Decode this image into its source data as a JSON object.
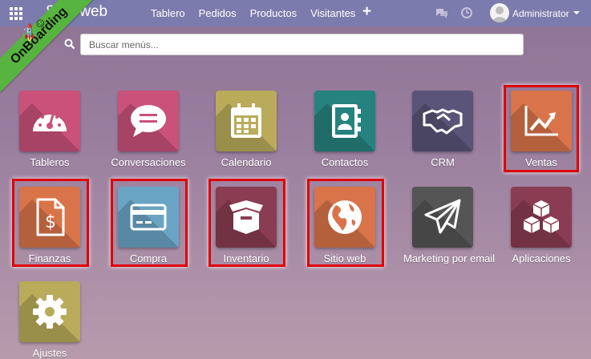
{
  "topbar": {
    "brand": "Sitio web",
    "nav": [
      "Tablero",
      "Pedidos",
      "Productos",
      "Visitantes"
    ],
    "plus": "+",
    "user": "Administrator",
    "icons": [
      "apps-grid-icon",
      "chat-icon",
      "clock-icon",
      "avatar"
    ],
    "color": "#7c7bad"
  },
  "ribbon": {
    "label": "OnBoarding",
    "icons": "🚀☺",
    "color": "#57b43f"
  },
  "search": {
    "placeholder": "Buscar menús..."
  },
  "apps": [
    {
      "label": "Tableros",
      "icon": "dashboard-gauge-icon",
      "color": "#c9517a",
      "highlighted": false
    },
    {
      "label": "Conversaciones",
      "icon": "chat-bubble-icon",
      "color": "#c9517a",
      "highlighted": false
    },
    {
      "label": "Calendario",
      "icon": "calendar-icon",
      "color": "#b9ab5a",
      "highlighted": false
    },
    {
      "label": "Contactos",
      "icon": "address-book-icon",
      "color": "#26827f",
      "highlighted": false
    },
    {
      "label": "CRM",
      "icon": "handshake-icon",
      "color": "#5a5478",
      "highlighted": false
    },
    {
      "label": "Ventas",
      "icon": "sales-chart-icon",
      "color": "#d9744a",
      "highlighted": true
    },
    {
      "label": "Finanzas",
      "icon": "invoice-dollar-icon",
      "color": "#d9744a",
      "highlighted": true
    },
    {
      "label": "Compra",
      "icon": "credit-card-icon",
      "color": "#6aa4c4",
      "highlighted": true
    },
    {
      "label": "Inventario",
      "icon": "box-icon",
      "color": "#8a3d52",
      "highlighted": true
    },
    {
      "label": "Sitio web",
      "icon": "globe-icon",
      "color": "#d9744a",
      "highlighted": true
    },
    {
      "label": "Marketing por email",
      "icon": "paper-plane-icon",
      "color": "#555555",
      "highlighted": false
    },
    {
      "label": "Aplicaciones",
      "icon": "cubes-icon",
      "color": "#8a3d52",
      "highlighted": false
    },
    {
      "label": "Ajustes",
      "icon": "gear-icon",
      "color": "#b9ab5a",
      "highlighted": false
    }
  ],
  "highlight_color": "#e00000"
}
